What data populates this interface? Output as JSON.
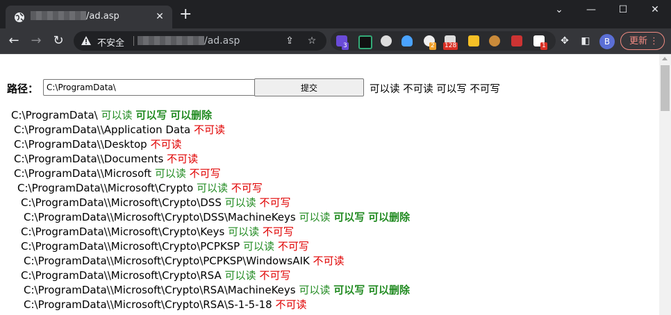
{
  "browser": {
    "tab_title": "/ad.asp",
    "address_insecure": "不安全",
    "address_url": "/ad.asp",
    "update_label": "更新",
    "avatar_letter": "B",
    "ext_badges": [
      "3",
      "2",
      "128",
      "1"
    ]
  },
  "form": {
    "path_label": "路径：",
    "path_value": "C:\\ProgramData\\",
    "submit_label": "提交",
    "summary": "可以读 不可读 可以写 不可写"
  },
  "entries": [
    {
      "path": "C:\\ProgramData\\",
      "read": "可以读",
      "write": "可以写",
      "delete": "可以删除"
    },
    {
      "path": "C:\\ProgramData\\\\Application Data",
      "read": "不可读"
    },
    {
      "path": "C:\\ProgramData\\\\Desktop",
      "read": "不可读"
    },
    {
      "path": "C:\\ProgramData\\\\Documents",
      "read": "不可读"
    },
    {
      "path": "C:\\ProgramData\\\\Microsoft",
      "read": "可以读",
      "write": "不可写"
    },
    {
      "path": "C:\\ProgramData\\\\Microsoft\\Crypto",
      "read": "可以读",
      "write": "不可写"
    },
    {
      "path": "C:\\ProgramData\\\\Microsoft\\Crypto\\DSS",
      "read": "可以读",
      "write": "不可写"
    },
    {
      "path": "C:\\ProgramData\\\\Microsoft\\Crypto\\DSS\\MachineKeys",
      "read": "可以读",
      "write": "可以写",
      "delete": "可以删除"
    },
    {
      "path": "C:\\ProgramData\\\\Microsoft\\Crypto\\Keys",
      "read": "可以读",
      "write": "不可写"
    },
    {
      "path": "C:\\ProgramData\\\\Microsoft\\Crypto\\PCPKSP",
      "read": "可以读",
      "write": "不可写"
    },
    {
      "path": "C:\\ProgramData\\\\Microsoft\\Crypto\\PCPKSP\\WindowsAIK",
      "read": "不可读"
    },
    {
      "path": "C:\\ProgramData\\\\Microsoft\\Crypto\\RSA",
      "read": "可以读",
      "write": "不可写"
    },
    {
      "path": "C:\\ProgramData\\\\Microsoft\\Crypto\\RSA\\MachineKeys",
      "read": "可以读",
      "write": "可以写",
      "delete": "可以删除"
    },
    {
      "path": "C:\\ProgramData\\\\Microsoft\\Crypto\\RSA\\S-1-5-18",
      "read": "不可读"
    }
  ],
  "colors": {
    "allowed": "#228b22",
    "denied": "#e00000",
    "chrome_dark": "#202124",
    "chrome_toolbar": "#35363a"
  }
}
